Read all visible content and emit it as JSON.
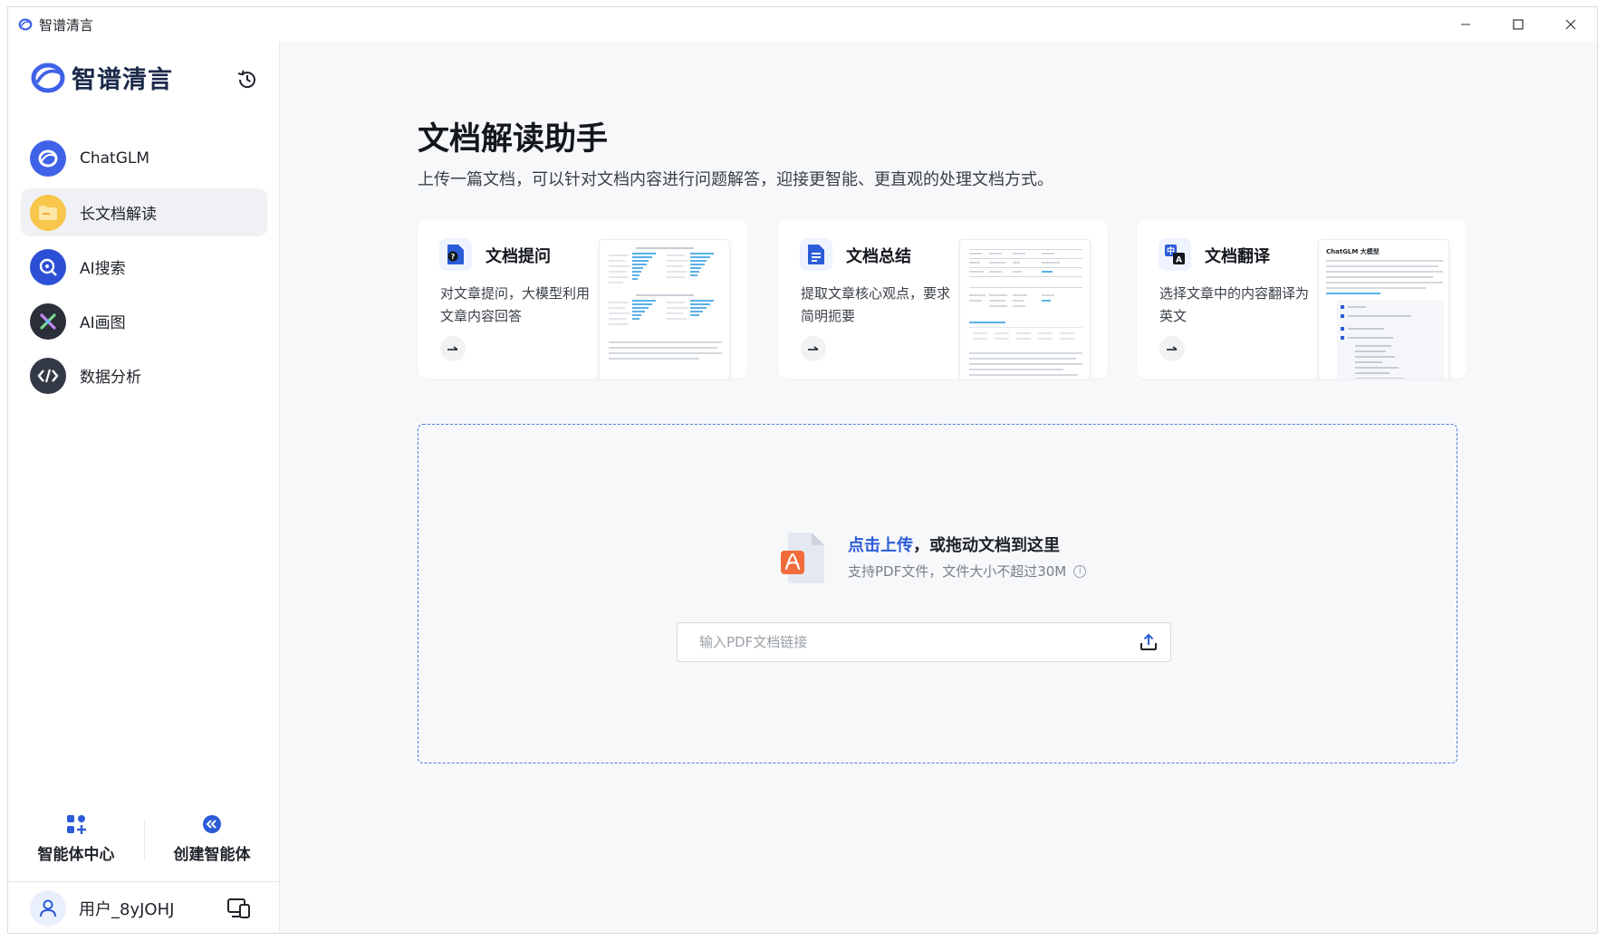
{
  "window": {
    "title": "智谱清言"
  },
  "brand": {
    "name": "智谱清言"
  },
  "nav": {
    "items": [
      {
        "label": "ChatGLM"
      },
      {
        "label": "长文档解读"
      },
      {
        "label": "AI搜索"
      },
      {
        "label": "AI画图"
      },
      {
        "label": "数据分析"
      }
    ],
    "active_index": 1
  },
  "agents": {
    "center_label": "智能体中心",
    "create_label": "创建智能体"
  },
  "user": {
    "name": "用户_8yJOHJ"
  },
  "main": {
    "title": "文档解读助手",
    "subtitle": "上传一篇文档，可以针对文档内容进行问题解答，迎接更智能、更直观的处理文档方式。",
    "cards": [
      {
        "title": "文档提问",
        "description": "对文章提问，大模型利用文章内容回答"
      },
      {
        "title": "文档总结",
        "description": "提取文章核心观点，要求简明扼要"
      },
      {
        "title": "文档翻译",
        "description": "选择文章中的内容翻译为英文",
        "thumb_heading": "ChatGLM 大模型"
      }
    ],
    "upload": {
      "link_text": "点击上传",
      "rest_text": "，或拖动文档到这里",
      "hint": "支持PDF文件，文件大小不超过30M",
      "url_placeholder": "输入PDF文档链接",
      "url_value": ""
    }
  },
  "colors": {
    "accent": "#2b5cd8",
    "brand_blue": "#3f62e8",
    "pdf_red": "#f26b3a",
    "doc_yellow": "#f7c64a",
    "active_bg": "#eff1f4"
  }
}
